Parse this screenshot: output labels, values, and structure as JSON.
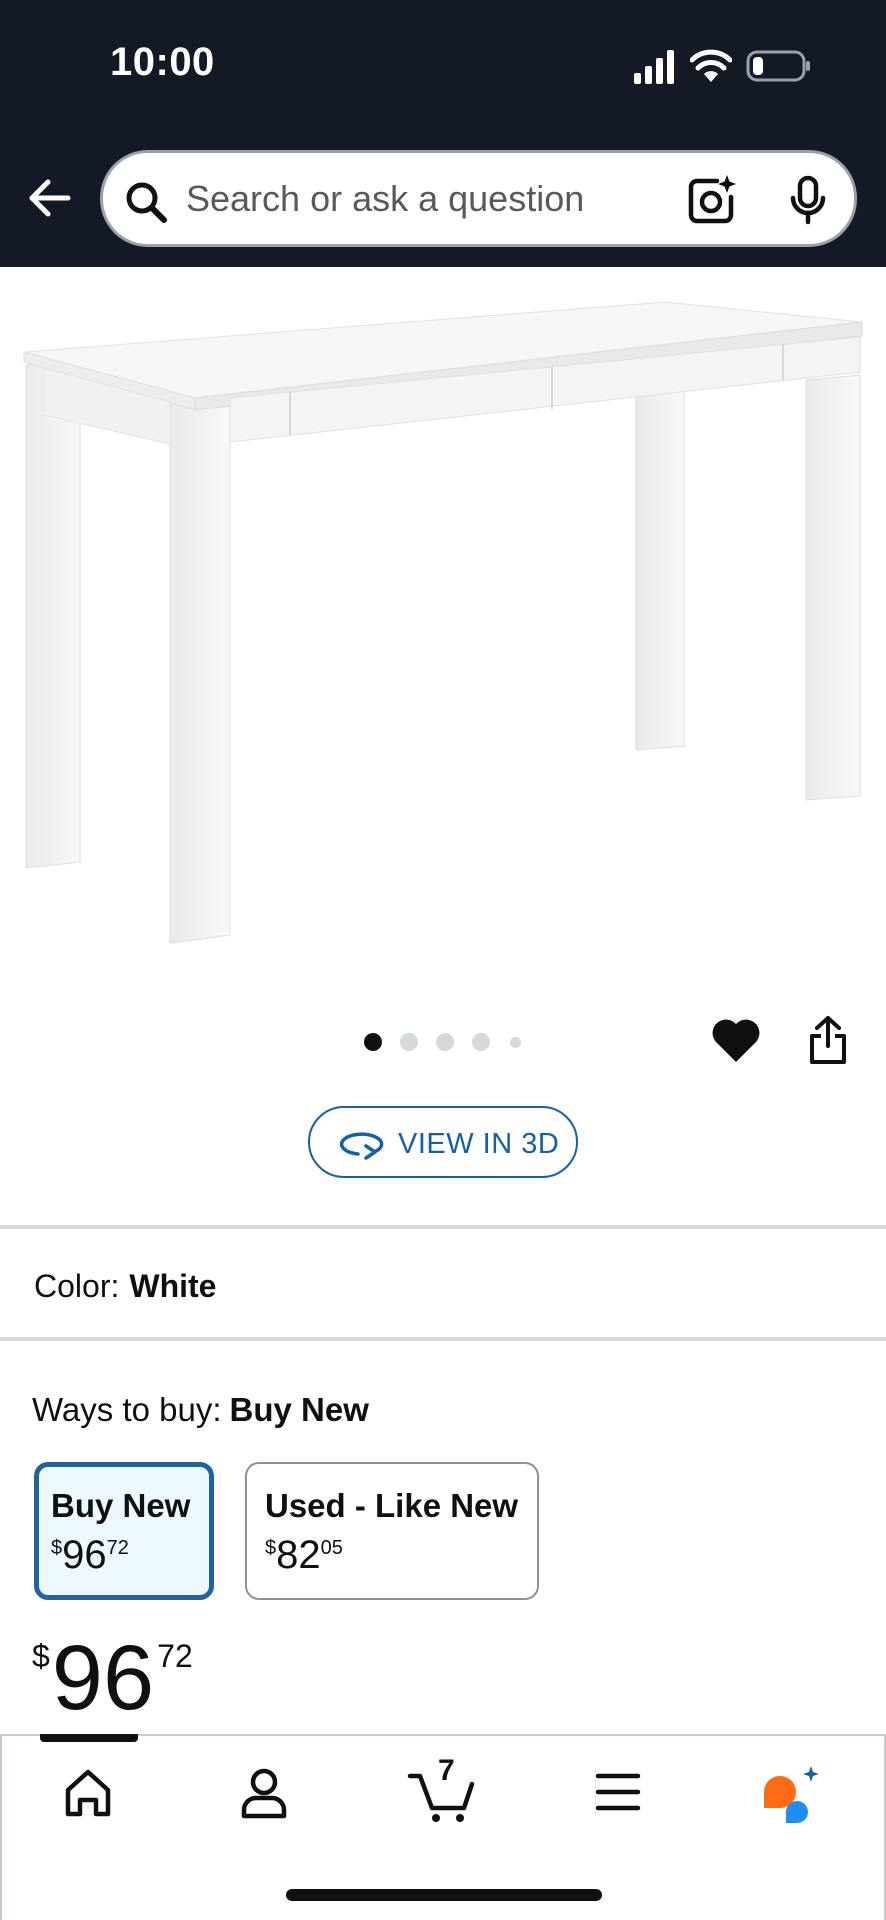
{
  "status_bar": {
    "time": "10:00"
  },
  "header": {
    "back_icon": "arrow-left-icon",
    "search": {
      "placeholder": "Search or ask a question",
      "value": ""
    },
    "camera_icon": "camera-sparkle-icon",
    "mic_icon": "microphone-icon"
  },
  "gallery": {
    "image_icon": "white-desk-product-image",
    "dots": {
      "count": 5,
      "active_index": 0
    },
    "wishlist_icon": "heart-icon",
    "share_icon": "share-icon",
    "view_3d_label": "VIEW IN 3D"
  },
  "color": {
    "label": "Color:",
    "value": "White"
  },
  "ways_to_buy": {
    "label": "Ways to buy:",
    "selected": "Buy New",
    "options": [
      {
        "title": "Buy New",
        "currency": "$",
        "price_whole": "96",
        "price_fraction": "72",
        "selected": true
      },
      {
        "title": "Used - Like New",
        "currency": "$",
        "price_whole": "82",
        "price_fraction": "05",
        "selected": false
      }
    ]
  },
  "price": {
    "currency": "$",
    "whole": "96",
    "fraction": "72"
  },
  "bottom_nav": {
    "items": [
      {
        "name": "home",
        "icon": "home-icon"
      },
      {
        "name": "account",
        "icon": "person-icon"
      },
      {
        "name": "cart",
        "icon": "cart-icon",
        "count": "7"
      },
      {
        "name": "menu",
        "icon": "hamburger-menu-icon"
      },
      {
        "name": "rufus",
        "icon": "rufus-chat-icon"
      }
    ]
  },
  "colors": {
    "header_bg": "#131a26",
    "link_blue": "#1560a8",
    "selected_border": "#2162a1",
    "selected_bg": "#edf8ff",
    "rufus_orange": "#ff6a13",
    "rufus_blue": "#1c8ff0"
  }
}
